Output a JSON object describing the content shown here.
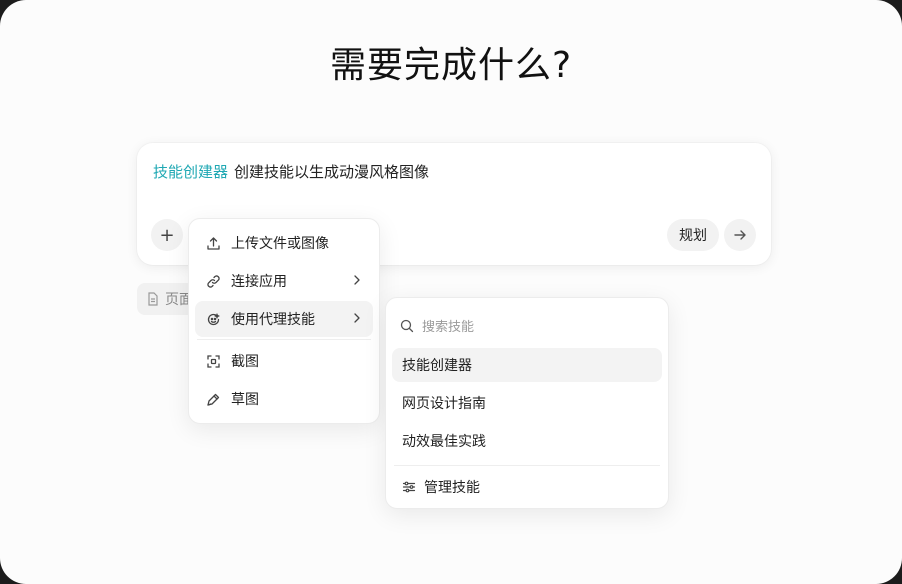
{
  "title": "需要完成什么?",
  "composer": {
    "skill_tag": "技能创建器",
    "prompt_text": "创建技能以生成动漫风格图像",
    "plus_label": "+",
    "plan_label": "规划"
  },
  "chip": {
    "label": "页面"
  },
  "menu": {
    "items": [
      {
        "label": "上传文件或图像",
        "icon": "upload-icon"
      },
      {
        "label": "连接应用",
        "icon": "link-icon"
      },
      {
        "label": "使用代理技能",
        "icon": "skill-icon"
      },
      {
        "label": "截图",
        "icon": "screenshot-icon"
      },
      {
        "label": "草图",
        "icon": "pen-icon"
      }
    ]
  },
  "submenu": {
    "search_placeholder": "搜索技能",
    "items": [
      {
        "label": "技能创建器"
      },
      {
        "label": "网页设计指南"
      },
      {
        "label": "动效最佳实践"
      }
    ],
    "manage_label": "管理技能"
  },
  "colors": {
    "accent": "#1fa8b3",
    "background": "#fcfcfc",
    "hover": "#f3f3f3"
  }
}
